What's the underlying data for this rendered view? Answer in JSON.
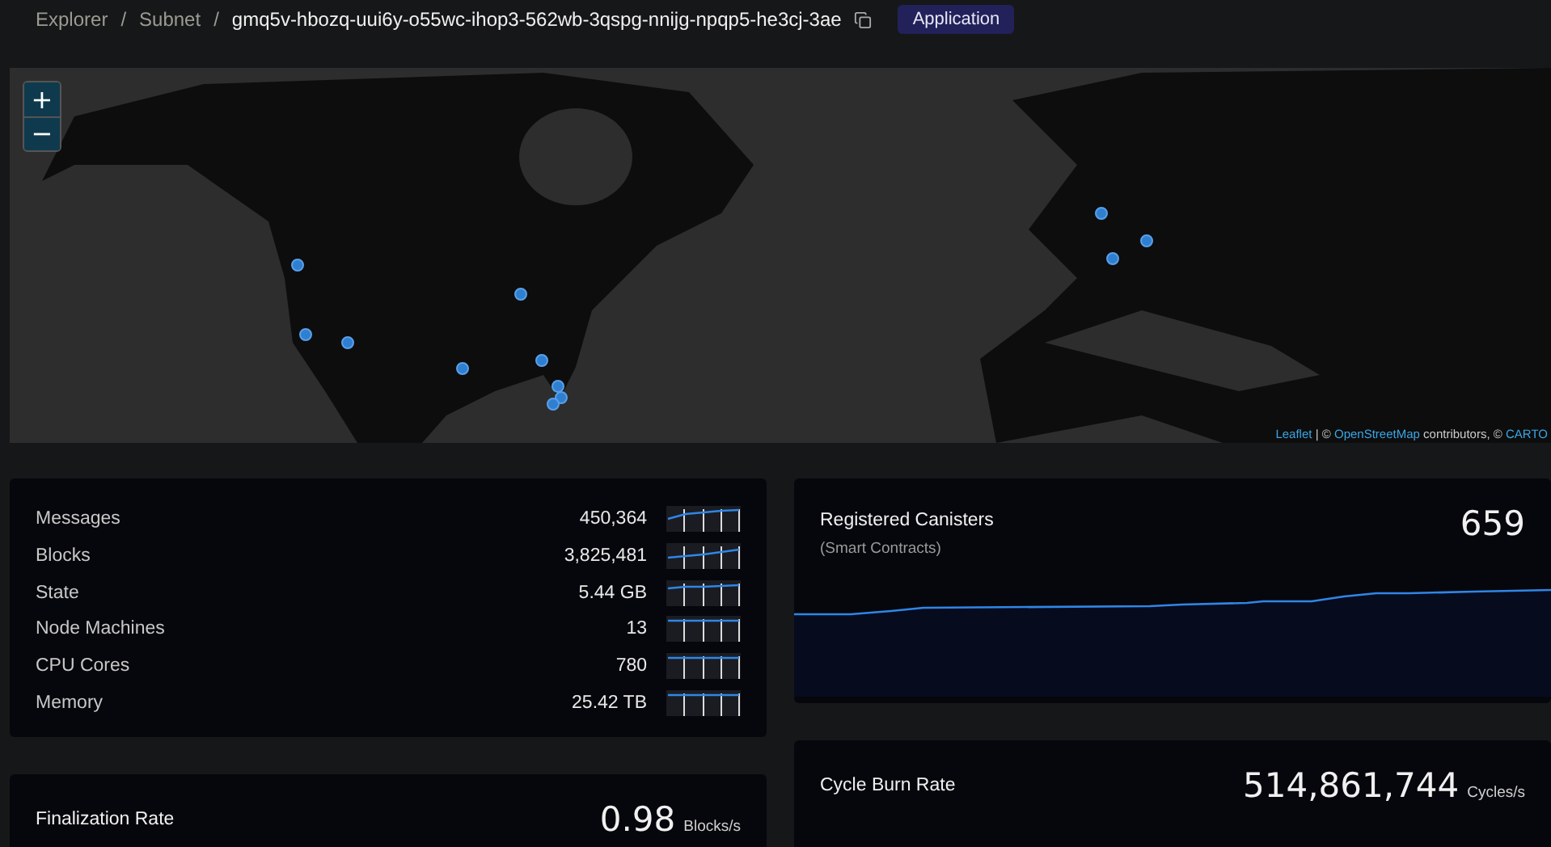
{
  "breadcrumb": [
    {
      "label": "Explorer",
      "separator": "/"
    },
    {
      "label": "Subnet",
      "separator": "/"
    }
  ],
  "subnet_id": "gmq5v-hbozq-uui6y-o55wc-ihop3-562wb-3qspg-nnijg-npqp5-he3cj-3ae",
  "badge": "Application",
  "map": {
    "zoom_in": "+",
    "zoom_out": "−",
    "attribution": {
      "leaflet": "Leaflet",
      "sep": "| ©",
      "osm": "OpenStreetMap",
      "contributors": "contributors, ©",
      "carto": "CARTO"
    }
  },
  "stats": [
    {
      "label": "Messages",
      "value": "450,364"
    },
    {
      "label": "Blocks",
      "value": "3,825,481"
    },
    {
      "label": "State",
      "value": "5.44 GB"
    },
    {
      "label": "Node Machines",
      "value": "13"
    },
    {
      "label": "CPU Cores",
      "value": "780"
    },
    {
      "label": "Memory",
      "value": "25.42 TB"
    }
  ],
  "canisters": {
    "title": "Registered Canisters",
    "subtitle": "(Smart Contracts)",
    "value": "659"
  },
  "finalization": {
    "title": "Finalization Rate",
    "value": "0.98",
    "unit": "Blocks/s"
  },
  "cycle_burn": {
    "title": "Cycle Burn Rate",
    "value": "514,861,744",
    "unit": "Cycles/s"
  }
}
